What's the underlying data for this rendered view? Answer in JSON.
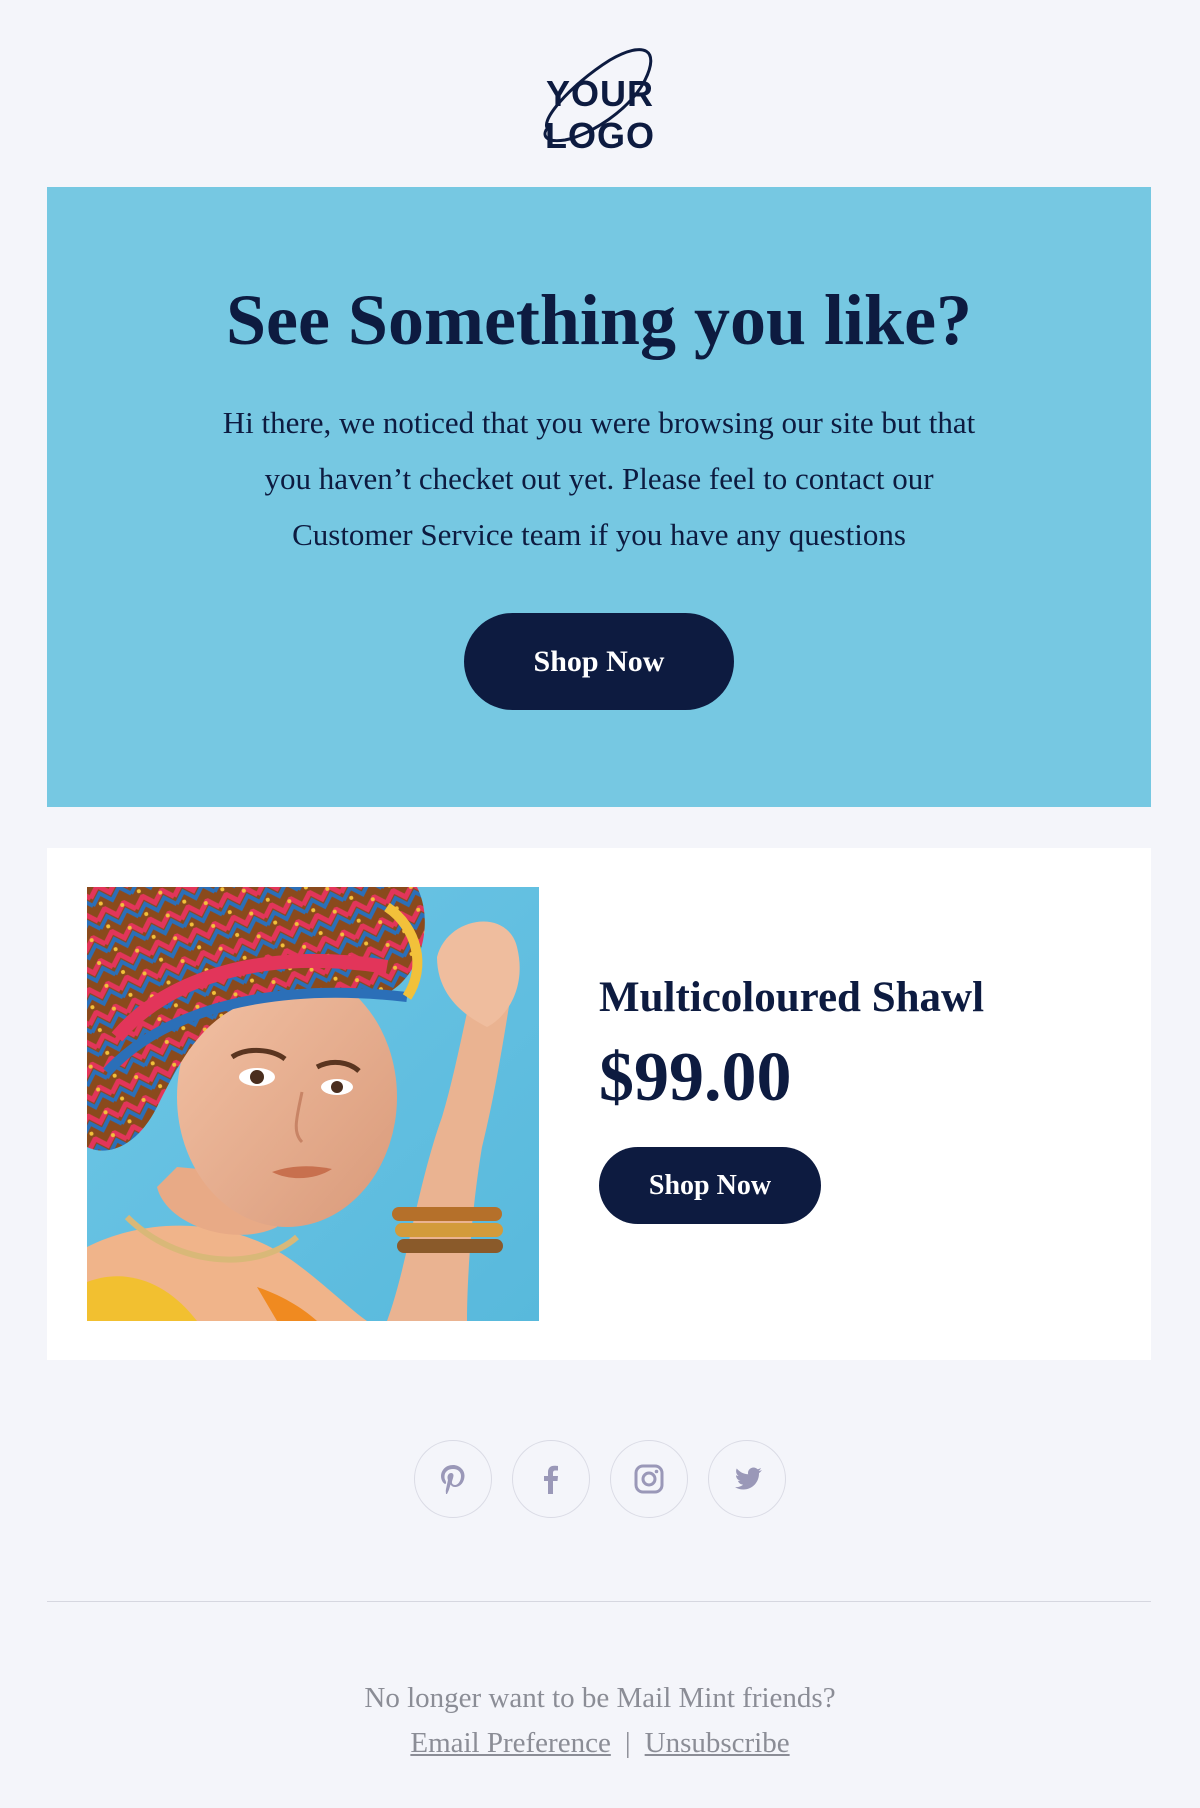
{
  "logo": {
    "text": "YOUR LOGO"
  },
  "hero": {
    "title": "See Something you like?",
    "body": "Hi there, we noticed that you were browsing our site but that you haven’t checket out yet. Please feel to contact our Customer Service team if you have any questions",
    "button_label": "Shop Now"
  },
  "product": {
    "name": "Multicoloured Shawl",
    "price": "$99.00",
    "button_label": "Shop Now"
  },
  "social": {
    "icons": [
      "pinterest-icon",
      "facebook-icon",
      "instagram-icon",
      "twitter-icon"
    ]
  },
  "footer": {
    "text": "No longer want to be Mail Mint friends?",
    "email_preference": "Email Preference",
    "separator": "|",
    "unsubscribe": "Unsubscribe"
  },
  "colors": {
    "background": "#f4f5fa",
    "hero_bg": "#76c8e2",
    "navy": "#0d1b40",
    "card_bg": "#ffffff",
    "footer_text": "#8b8d96",
    "social_icon": "#9a98b8"
  }
}
